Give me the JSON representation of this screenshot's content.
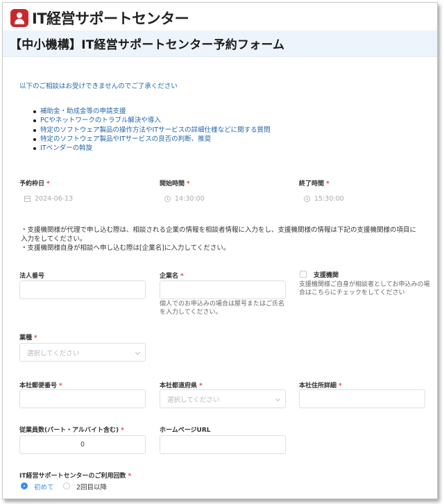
{
  "header": {
    "logo_text": "IT経営サポートセンター",
    "form_title": "【中小機構】IT経営サポートセンター予約フォーム"
  },
  "notice": {
    "text": "以下のご相談はお受けできませんのでご了承ください",
    "items": [
      "補助金・助成金等の申請支援",
      "PCやネットワークのトラブル解決や導入",
      "特定のソフトウェア製品の操作方法やITサービスの詳細仕様などに関する質問",
      "特定のソフトウェア製品やITサービスの良否の判断、推奨",
      "ITベンダーの斡旋"
    ]
  },
  "reservation": {
    "date_label": "予約枠日",
    "date_value": "2024-06-13",
    "start_label": "開始時間",
    "start_value": "14:30:00",
    "end_label": "終了時間",
    "end_value": "15:30:00"
  },
  "instructions": {
    "line1": "・支援機関様が代理で申し込む際は、相談される企業の情報を相談者情報に入力をし、支援機関様の情報は下記の支援機関様の項目に入力をしてください。",
    "line2": "・支援機関様自身が相談へ申し込む際は[企業名]に入力してください。"
  },
  "fields": {
    "corp_number_label": "法人番号",
    "corp_number_value": "",
    "company_label": "企業名",
    "company_value": "",
    "company_help": "個人でのお申込みの場合は屋号またはご氏名を入力してください。",
    "support_label": "支援機関",
    "support_help": "支援機関様ご自身が相談者としてお申込みの場合はこちらにチェックをしてください",
    "industry_label": "業種",
    "industry_placeholder": "選択してください",
    "zip_label": "本社郵便番号",
    "zip_value": "",
    "pref_label": "本社都道府県",
    "pref_placeholder": "選択してください",
    "address_label": "本社住所詳細",
    "address_value": "",
    "employees_label": "従業員数(パート・アルバイト含む)",
    "employees_value": "0",
    "homepage_label": "ホームページURL",
    "homepage_value": "",
    "usage_label": "IT経営サポートセンターのご利用回数",
    "usage_options": [
      "初めて",
      "2回目以降"
    ],
    "usage_selected": "初めて"
  },
  "colors": {
    "accent": "#3a8ee6",
    "required": "#e0463f",
    "notice_text": "#2266aa",
    "title_bg": "#eef4fb",
    "logo_red": "#c8282d"
  }
}
